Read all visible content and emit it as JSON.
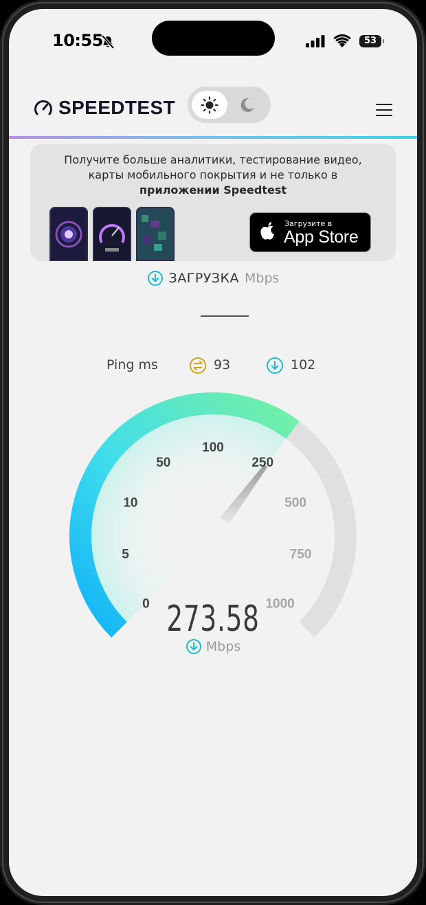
{
  "status_bar": {
    "time": "10:55",
    "battery": "53",
    "icons": [
      "bell-slash-icon",
      "cellular-signal-icon",
      "wifi-icon",
      "battery-icon"
    ]
  },
  "header": {
    "logo_text": "SPEEDTEST",
    "theme_light_icon": "sun-icon",
    "theme_dark_icon": "moon-icon",
    "menu_icon": "hamburger-menu-icon"
  },
  "promo": {
    "line1": "Получите больше аналитики, тестирование видео,",
    "line2": "карты мобильного покрытия и не только в",
    "line3_bold": "приложении Speedtest",
    "appstore_small": "Загрузите в",
    "appstore_big": "App Store"
  },
  "test": {
    "label": "ЗАГРУЗКА",
    "label_unit": "Mbps",
    "ping_label": "Ping ms",
    "ping_jitter": "93",
    "ping_download": "102",
    "speed_value": "273.58",
    "speed_unit": "Mbps"
  },
  "gauge": {
    "scale_labels": [
      "0",
      "5",
      "10",
      "50",
      "100",
      "250",
      "500",
      "750",
      "1000"
    ],
    "current_speed": 273.58,
    "colors": {
      "start": "#17b6f4",
      "end": "#68eeb1",
      "track": "#e0e0e0"
    }
  }
}
